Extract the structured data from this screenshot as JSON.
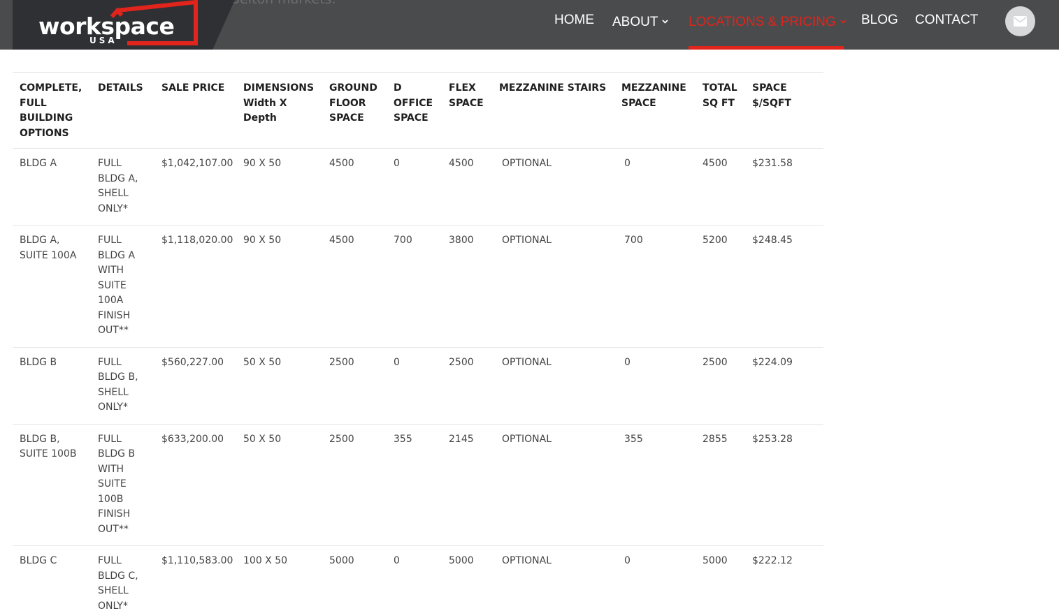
{
  "header": {
    "background_text": "Belton markets.",
    "logo": {
      "word": "workspace",
      "sub": "USA"
    },
    "nav": [
      {
        "label": "HOME",
        "active": false,
        "dropdown": false
      },
      {
        "label": "ABOUT",
        "active": false,
        "dropdown": true
      },
      {
        "label": "LOCATIONS & PRICING",
        "active": true,
        "dropdown": true
      },
      {
        "label": "BLOG",
        "active": false,
        "dropdown": false
      },
      {
        "label": "CONTACT",
        "active": false,
        "dropdown": false
      }
    ],
    "mail_icon": "envelope-icon",
    "colors": {
      "header_bg": "#4a4b4d",
      "accent": "#e1241c",
      "logo_bg": "#2f3033"
    }
  },
  "table": {
    "columns": [
      "COMPLETE, FULL BUILDING OPTIONS",
      "DETAILS",
      "SALE PRICE",
      "DIMENSIONS Width X Depth",
      "GROUND FLOOR SPACE",
      "D OFFICE SPACE",
      "FLEX SPACE",
      "MEZZANINE STAIRS",
      "MEZZANINE SPACE",
      "TOTAL SQ FT",
      "SPACE $/SQFT"
    ],
    "rows": [
      [
        "BLDG A",
        "FULL BLDG A, SHELL ONLY*",
        "$1,042,107.00",
        "90 X 50",
        "4500",
        "0",
        "4500",
        "OPTIONAL",
        "0",
        "4500",
        "$231.58"
      ],
      [
        "BLDG A, SUITE 100A",
        "FULL BLDG A WITH SUITE 100A FINISH OUT**",
        "$1,118,020.00",
        "90 X 50",
        "4500",
        "700",
        "3800",
        "OPTIONAL",
        "700",
        "5200",
        "$248.45"
      ],
      [
        "BLDG B",
        "FULL BLDG B, SHELL ONLY*",
        "$560,227.00",
        "50 X 50",
        "2500",
        "0",
        "2500",
        "OPTIONAL",
        "0",
        "2500",
        "$224.09"
      ],
      [
        "BLDG B, SUITE 100B",
        "FULL BLDG B WITH SUITE 100B FINISH OUT**",
        "$633,200.00",
        "50 X 50",
        "2500",
        "355",
        "2145",
        "OPTIONAL",
        "355",
        "2855",
        "$253.28"
      ],
      [
        "BLDG C",
        "FULL BLDG C, SHELL ONLY*",
        "$1,110,583.00",
        "100 X 50",
        "5000",
        "0",
        "5000",
        "OPTIONAL",
        "0",
        "5000",
        "$222.12"
      ]
    ]
  }
}
